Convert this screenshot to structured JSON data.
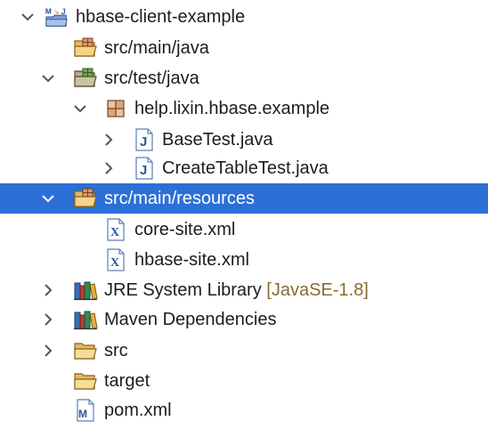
{
  "colors": {
    "selection": "#2c6fd6",
    "text": "#1d1d1d",
    "selected_text": "#ffffff",
    "decoration": "#8a6a33"
  },
  "tree": {
    "project": {
      "label": "hbase-client-example",
      "icon": "maven-java-project-icon"
    },
    "src_main_java": {
      "label": "src/main/java",
      "icon": "source-folder-icon"
    },
    "src_test_java": {
      "label": "src/test/java",
      "icon": "test-source-folder-icon"
    },
    "package": {
      "label": "help.lixin.hbase.example",
      "icon": "package-icon"
    },
    "base_test": {
      "label": "BaseTest.java",
      "icon": "java-file-icon"
    },
    "create_table_test": {
      "label": "CreateTableTest.java",
      "icon": "java-file-icon"
    },
    "src_main_resources": {
      "label": "src/main/resources",
      "icon": "source-folder-icon"
    },
    "core_site": {
      "label": "core-site.xml",
      "icon": "xml-file-icon"
    },
    "hbase_site": {
      "label": "hbase-site.xml",
      "icon": "xml-file-icon"
    },
    "jre": {
      "label": "JRE System Library",
      "suffix": "[JavaSE-1.8]",
      "icon": "library-icon"
    },
    "maven_deps": {
      "label": "Maven Dependencies",
      "icon": "library-icon"
    },
    "src": {
      "label": "src",
      "icon": "folder-icon"
    },
    "target": {
      "label": "target",
      "icon": "folder-icon"
    },
    "pom": {
      "label": "pom.xml",
      "icon": "maven-pom-icon"
    }
  }
}
